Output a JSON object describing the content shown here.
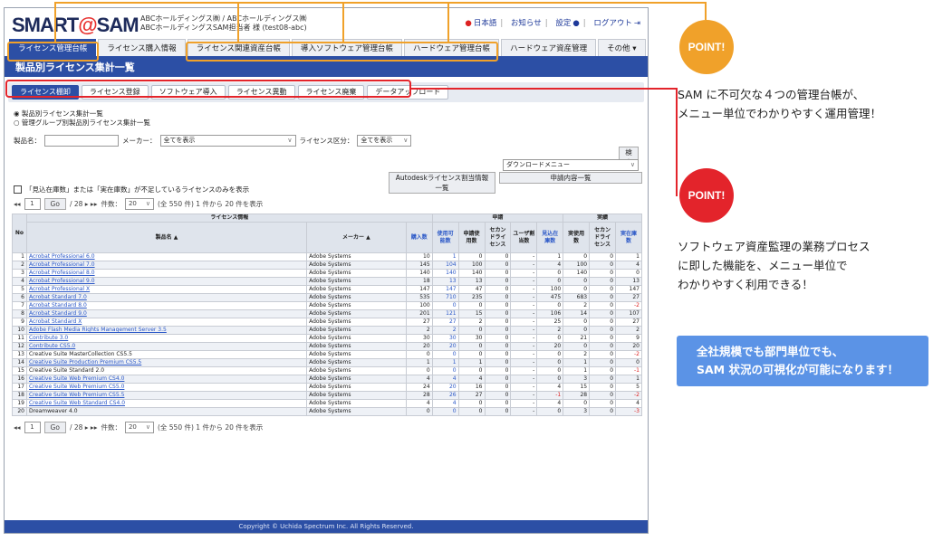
{
  "header": {
    "logo_a": "SMART",
    "logo_at": "@",
    "logo_b": "SAM",
    "company1": "ABCホールディングス㈱ / ABCホールディングス㈱",
    "company2": "ABCホールディングスSAM担当者 様 (test08-abc)",
    "lang": "日本語",
    "news": "お知らせ",
    "settings": "設定",
    "logout": "ログアウト"
  },
  "nav": [
    "ライセンス管理台帳",
    "ライセンス購入情報",
    "ライセンス関連資産台帳",
    "導入ソフトウェア管理台帳",
    "ハードウェア管理台帳",
    "ハードウェア資産管理",
    "その他 ▾"
  ],
  "page_title": "製品別ライセンス集計一覧",
  "subnav": [
    "ライセンス棚卸",
    "ライセンス登録",
    "ソフトウェア導入",
    "ライセンス異動",
    "ライセンス廃棄",
    "データアップロード"
  ],
  "radios": [
    "◉ 製品別ライセンス集計一覧",
    "○ 管理グループ別製品別ライセンス集計一覧"
  ],
  "filters": {
    "product_label": "製品名：",
    "maker_label": "メーカー：",
    "maker_value": "全てを表示",
    "ltype_label": "ライセンス区分：",
    "ltype_value": "全てを表示"
  },
  "buttons": {
    "search": "検索",
    "download": "ダウンロードメニュー",
    "autodesk": "Autodeskライセンス割当情報一覧",
    "request": "申請内容一覧",
    "go": "Go"
  },
  "checkbox_label": "「見込在庫数」または「実在庫数」が不足しているライセンスのみを表示",
  "pager": {
    "page": "1",
    "total": "/ 28 ▸ ▸▸",
    "count_label": "件数：",
    "count": "20",
    "info": "(全 550 件) 1 件から 20 件を表示"
  },
  "table": {
    "g_info": "ライセンス情報",
    "g_app": "申請",
    "g_act": "実績",
    "h_no": "No",
    "h_name": "製品名 ▲",
    "h_maker": "メーカー ▲",
    "h_cols": [
      "購入数",
      "使用可能数",
      "申請使用数",
      "セカンドライセンス",
      "ユーザ割当数",
      "見込在庫数",
      "実使用数",
      "セカンドライセンス",
      "実在庫数"
    ],
    "rows": [
      [
        "1",
        "Acrobat Professional 6.0",
        "Adobe Systems",
        "10",
        "1",
        "0",
        "0",
        "-",
        "1",
        "0",
        "0",
        "1",
        1
      ],
      [
        "2",
        "Acrobat Professional 7.0",
        "Adobe Systems",
        "145",
        "104",
        "100",
        "0",
        "-",
        "4",
        "100",
        "0",
        "4",
        1
      ],
      [
        "3",
        "Acrobat Professional 8.0",
        "Adobe Systems",
        "140",
        "140",
        "140",
        "0",
        "-",
        "0",
        "140",
        "0",
        "0",
        1
      ],
      [
        "4",
        "Acrobat Professional 9.0",
        "Adobe Systems",
        "18",
        "13",
        "13",
        "0",
        "-",
        "0",
        "0",
        "0",
        "13",
        1
      ],
      [
        "5",
        "Acrobat Professional X",
        "Adobe Systems",
        "147",
        "147",
        "47",
        "0",
        "-",
        "100",
        "0",
        "0",
        "147",
        1
      ],
      [
        "6",
        "Acrobat Standard 7.0",
        "Adobe Systems",
        "535",
        "710",
        "235",
        "0",
        "-",
        "475",
        "683",
        "0",
        "27",
        1
      ],
      [
        "7",
        "Acrobat Standard 8.0",
        "Adobe Systems",
        "100",
        "0",
        "0",
        "0",
        "-",
        "0",
        "2",
        "0",
        "-2",
        1
      ],
      [
        "8",
        "Acrobat Standard 9.0",
        "Adobe Systems",
        "201",
        "121",
        "15",
        "0",
        "-",
        "106",
        "14",
        "0",
        "107",
        1
      ],
      [
        "9",
        "Acrobat Standard X",
        "Adobe Systems",
        "27",
        "27",
        "2",
        "0",
        "-",
        "25",
        "0",
        "0",
        "27",
        1
      ],
      [
        "10",
        "Adobe Flash Media Rights Management Server 3.5",
        "Adobe Systems",
        "2",
        "2",
        "0",
        "0",
        "-",
        "2",
        "0",
        "0",
        "2",
        1
      ],
      [
        "11",
        "Contribute 3.0",
        "Adobe Systems",
        "30",
        "30",
        "30",
        "0",
        "-",
        "0",
        "21",
        "0",
        "9",
        1
      ],
      [
        "12",
        "Contribute CS5.0",
        "Adobe Systems",
        "20",
        "20",
        "0",
        "0",
        "-",
        "20",
        "0",
        "0",
        "20",
        1
      ],
      [
        "13",
        "Creative Suite MasterCollection CS5.5",
        "Adobe Systems",
        "0",
        "0",
        "0",
        "0",
        "-",
        "0",
        "2",
        "0",
        "-2",
        0
      ],
      [
        "14",
        "Creative Suite Production Premium CS5.5",
        "Adobe Systems",
        "1",
        "1",
        "1",
        "0",
        "-",
        "0",
        "1",
        "0",
        "0",
        1
      ],
      [
        "15",
        "Creative Suite Standard 2.0",
        "Adobe Systems",
        "0",
        "0",
        "0",
        "0",
        "-",
        "0",
        "1",
        "0",
        "-1",
        0
      ],
      [
        "16",
        "Creative Suite Web Premium CS4.0",
        "Adobe Systems",
        "4",
        "4",
        "4",
        "0",
        "-",
        "0",
        "3",
        "0",
        "1",
        1
      ],
      [
        "17",
        "Creative Suite Web Premium CS5.0",
        "Adobe Systems",
        "24",
        "20",
        "16",
        "0",
        "-",
        "4",
        "15",
        "0",
        "5",
        1
      ],
      [
        "18",
        "Creative Suite Web Premium CS5.5",
        "Adobe Systems",
        "28",
        "26",
        "27",
        "0",
        "-",
        "-1",
        "28",
        "0",
        "-2",
        1
      ],
      [
        "19",
        "Creative Suite Web Standard CS4.0",
        "Adobe Systems",
        "4",
        "4",
        "0",
        "0",
        "-",
        "4",
        "0",
        "0",
        "4",
        1
      ],
      [
        "20",
        "Dreamweaver 4.0",
        "Adobe Systems",
        "0",
        "0",
        "0",
        "0",
        "-",
        "0",
        "3",
        "0",
        "-3",
        0
      ]
    ]
  },
  "footer": "Copyright © Uchida Spectrum Inc. All Rights Reserved.",
  "callout1": {
    "badge": "POINT!",
    "lines": [
      "SAM に不可欠な４つの管理台帳が、",
      "メニュー単位でわかりやすく運用管理！"
    ]
  },
  "callout2": {
    "badge": "POINT!",
    "lines": [
      "ソフトウェア資産監理の業務プロセス",
      "に即した機能を、メニュー単位で",
      "わかりやすく利用できる！"
    ]
  },
  "banner": [
    "全社規模でも部門単位でも、",
    "SAM 状況の可視化が可能になります！"
  ],
  "colors": {
    "primary": "#2c4fa5",
    "orange": "#f0a12a",
    "red": "#e3242b",
    "banner": "#5b93e6"
  }
}
